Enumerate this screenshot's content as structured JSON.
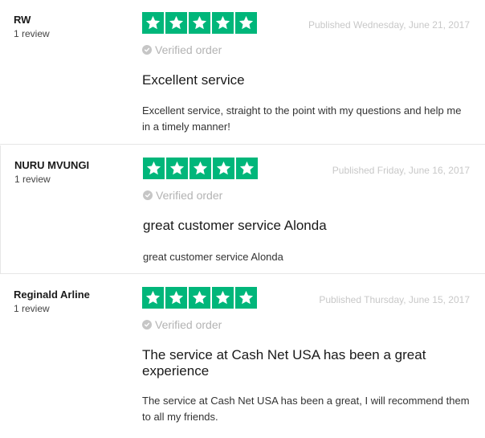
{
  "brand": {
    "star_color": "#00b67a"
  },
  "reviews": [
    {
      "author": "RW",
      "review_count": "1 review",
      "rating": 5,
      "published": "Published Wednesday, June 21, 2017",
      "verified": "Verified order",
      "title": "Excellent service",
      "body": "Excellent service, straight to the point with my questions and help me in a timely manner!"
    },
    {
      "author": "NURU MVUNGI",
      "review_count": "1 review",
      "rating": 5,
      "published": "Published Friday, June 16, 2017",
      "verified": "Verified order",
      "title": "great customer service Alonda",
      "body": "great customer service Alonda"
    },
    {
      "author": "Reginald Arline",
      "review_count": "1 review",
      "rating": 5,
      "published": "Published Thursday, June 15, 2017",
      "verified": "Verified order",
      "title": "The service at Cash Net USA has been a great experience",
      "body": "The service at Cash Net USA has been a great, I will recommend them to all my friends."
    }
  ],
  "icons": {
    "star": "star-icon",
    "verified": "check-circle-icon"
  }
}
